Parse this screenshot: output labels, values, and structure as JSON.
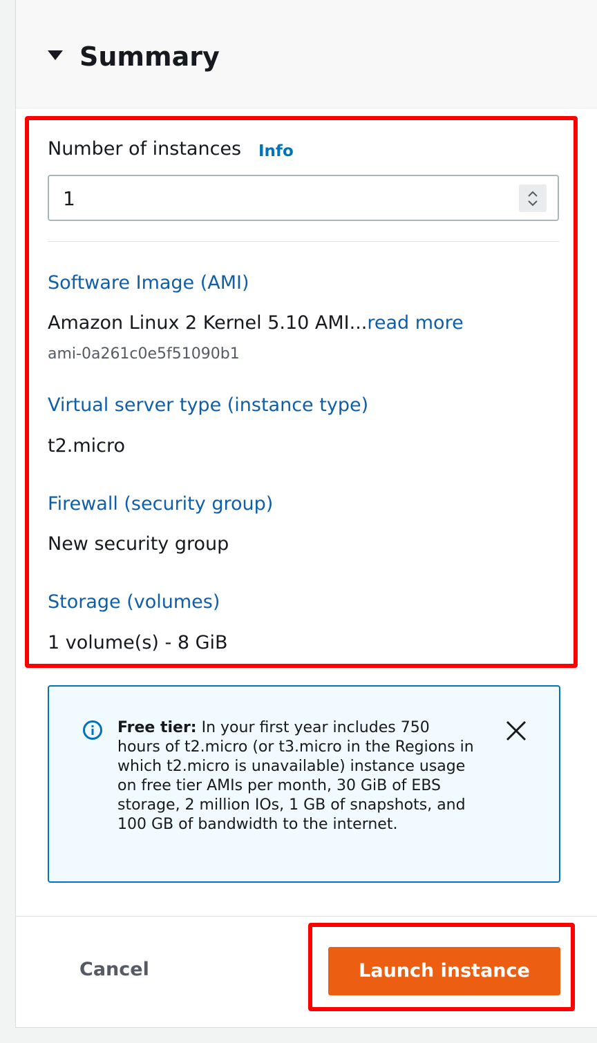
{
  "summary": {
    "title": "Summary"
  },
  "instances": {
    "label": "Number of instances",
    "info": "Info",
    "value": "1"
  },
  "ami": {
    "label": "Software Image (AMI)",
    "name": "Amazon Linux 2 Kernel 5.10 AMI...",
    "read_more": "read more",
    "id": "ami-0a261c0e5f51090b1"
  },
  "instance_type": {
    "label": "Virtual server type (instance type)",
    "value": "t2.micro"
  },
  "firewall": {
    "label": "Firewall (security group)",
    "value": "New security group"
  },
  "storage": {
    "label": "Storage (volumes)",
    "value": "1 volume(s) - 8 GiB"
  },
  "free_tier": {
    "bold": "Free tier:",
    "text": " In your first year includes 750 hours of t2.micro (or t3.micro in the Regions in which t2.micro is unavailable) instance usage on free tier AMIs per month, 30 GiB of EBS storage, 2 million IOs, 1 GB of snapshots, and 100 GB of bandwidth to the internet."
  },
  "actions": {
    "cancel": "Cancel",
    "launch": "Launch instance"
  },
  "icons": {
    "caret": "caret-down-icon",
    "info": "info-circle-icon",
    "close": "close-icon",
    "stepper": "stepper-icon"
  },
  "colors": {
    "link": "#0f5ea8",
    "primary_button": "#ec5f13",
    "highlight": "#ff0000",
    "alert_bg": "#f1faff",
    "alert_border": "#0073bb"
  }
}
